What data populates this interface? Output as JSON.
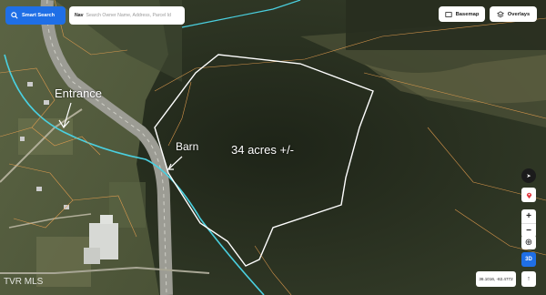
{
  "toolbar": {
    "smart_search_label": "Smart Search",
    "search_prefix": "Nav",
    "search_placeholder": "Search Owner Name, Address, Parcel Id",
    "basemap_label": "Basemap",
    "overlays_label": "Overlays"
  },
  "controls": {
    "threed_label": "3D",
    "coordinates": "36.1016, -82.4772"
  },
  "annotations": {
    "entrance": "Entrance",
    "barn": "Barn",
    "acreage": "34 acres +/-"
  },
  "watermark": "TVR MLS",
  "colors": {
    "accent": "#1f6fe6",
    "property_outline": "#ffffff",
    "parcel_lines": "#e8a050",
    "streams": "#4ad0e0"
  },
  "icons": [
    "search-icon",
    "layers-icon",
    "compass-icon",
    "location-pin-icon",
    "plus-icon",
    "minus-icon",
    "locate-icon",
    "north-arrow-icon"
  ]
}
